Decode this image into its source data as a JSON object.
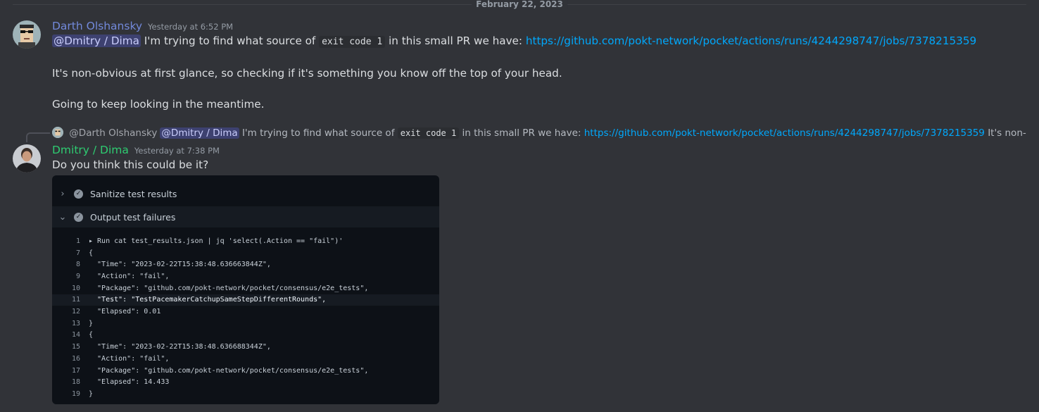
{
  "divider": {
    "date": "February 22, 2023"
  },
  "messages": [
    {
      "author": "Darth Olshansky",
      "author_color": "#7289da",
      "time": "Yesterday at 6:52 PM",
      "line1": {
        "mention": "@Dmitry / Dima",
        "t1": "I'm trying to find what source of",
        "code": "exit code 1",
        "t2": "in this small PR we have:",
        "link": "https://github.com/pokt-network/pocket/actions/runs/4244298747/jobs/7378215359"
      },
      "line2": "It's non-obvious at first glance, so checking if it's something you know off the top of your head.",
      "line3": "Going to keep looking in the meantime."
    },
    {
      "reply": {
        "author": "@Darth Olshansky",
        "mention": "@Dmitry / Dima",
        "t1": "I'm trying to find what source of",
        "code": "exit code 1",
        "t2": "in this small PR we have:",
        "link": "https://github.com/pokt-network/pocket/actions/runs/4244298747/jobs/7378215359",
        "t3": "It's non-obvious at first glance, s"
      },
      "author": "Dmitry / Dima",
      "author_color": "#2ecc71",
      "time": "Yesterday at 7:38 PM",
      "text": "Do you think this could be it?",
      "embed": {
        "steps": [
          {
            "chevron": "›",
            "label": "Sanitize test results"
          },
          {
            "chevron": "⌄",
            "label": "Output test failures"
          }
        ],
        "lines": [
          {
            "n": "1",
            "text": "▸ Run cat test_results.json | jq 'select(.Action == \"fail\")'"
          },
          {
            "n": "7",
            "text": "{"
          },
          {
            "n": "8",
            "text": "  \"Time\": \"2023-02-22T15:38:48.636663844Z\","
          },
          {
            "n": "9",
            "text": "  \"Action\": \"fail\","
          },
          {
            "n": "10",
            "text": "  \"Package\": \"github.com/pokt-network/pocket/consensus/e2e_tests\","
          },
          {
            "n": "11",
            "text": "  \"Test\": \"TestPacemakerCatchupSameStepDifferentRounds\","
          },
          {
            "n": "12",
            "text": "  \"Elapsed\": 0.01"
          },
          {
            "n": "13",
            "text": "}"
          },
          {
            "n": "14",
            "text": "{"
          },
          {
            "n": "15",
            "text": "  \"Time\": \"2023-02-22T15:38:48.636688344Z\","
          },
          {
            "n": "16",
            "text": "  \"Action\": \"fail\","
          },
          {
            "n": "17",
            "text": "  \"Package\": \"github.com/pokt-network/pocket/consensus/e2e_tests\","
          },
          {
            "n": "18",
            "text": "  \"Elapsed\": 14.433"
          },
          {
            "n": "19",
            "text": "}"
          }
        ]
      }
    }
  ]
}
